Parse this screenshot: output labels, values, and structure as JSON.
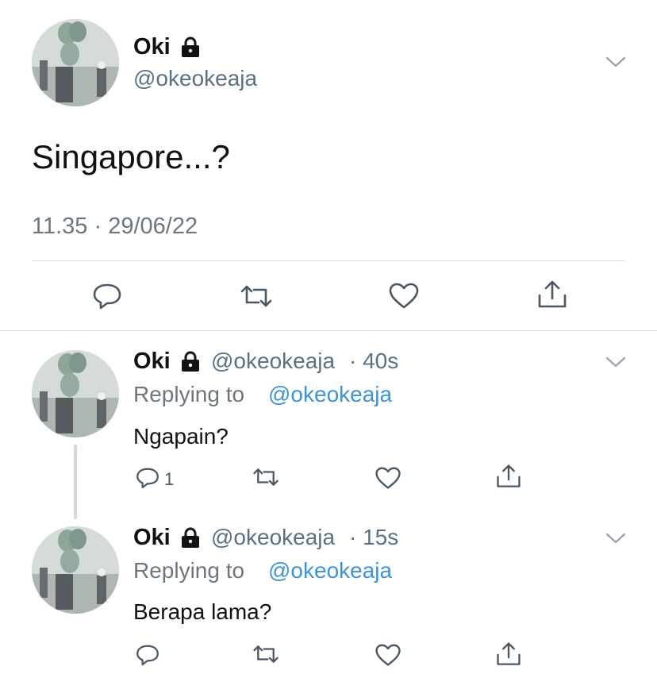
{
  "main_tweet": {
    "name": "Oki",
    "handle": "@okeokeaja",
    "text": "Singapore...?",
    "timestamp": "11.35 · 29/06/22"
  },
  "replies": [
    {
      "name": "Oki",
      "handle": "@okeokeaja",
      "time": "· 40s",
      "replying_prefix": "Replying to",
      "replying_handle": "@okeokeaja",
      "text": "Ngapain?",
      "reply_count": "1"
    },
    {
      "name": "Oki",
      "handle": "@okeokeaja",
      "time": "· 15s",
      "replying_prefix": "Replying to",
      "replying_handle": "@okeokeaja",
      "text": "Berapa lama?",
      "reply_count": ""
    }
  ],
  "icons": {
    "reply": "reply-icon",
    "retweet": "retweet-icon",
    "like": "heart-icon",
    "share": "share-icon",
    "lock": "lock-icon",
    "more": "chevron-down-icon"
  },
  "colors": {
    "link": "#3b94d9",
    "secondary": "#6e767d",
    "divider": "#dcdfe2"
  }
}
